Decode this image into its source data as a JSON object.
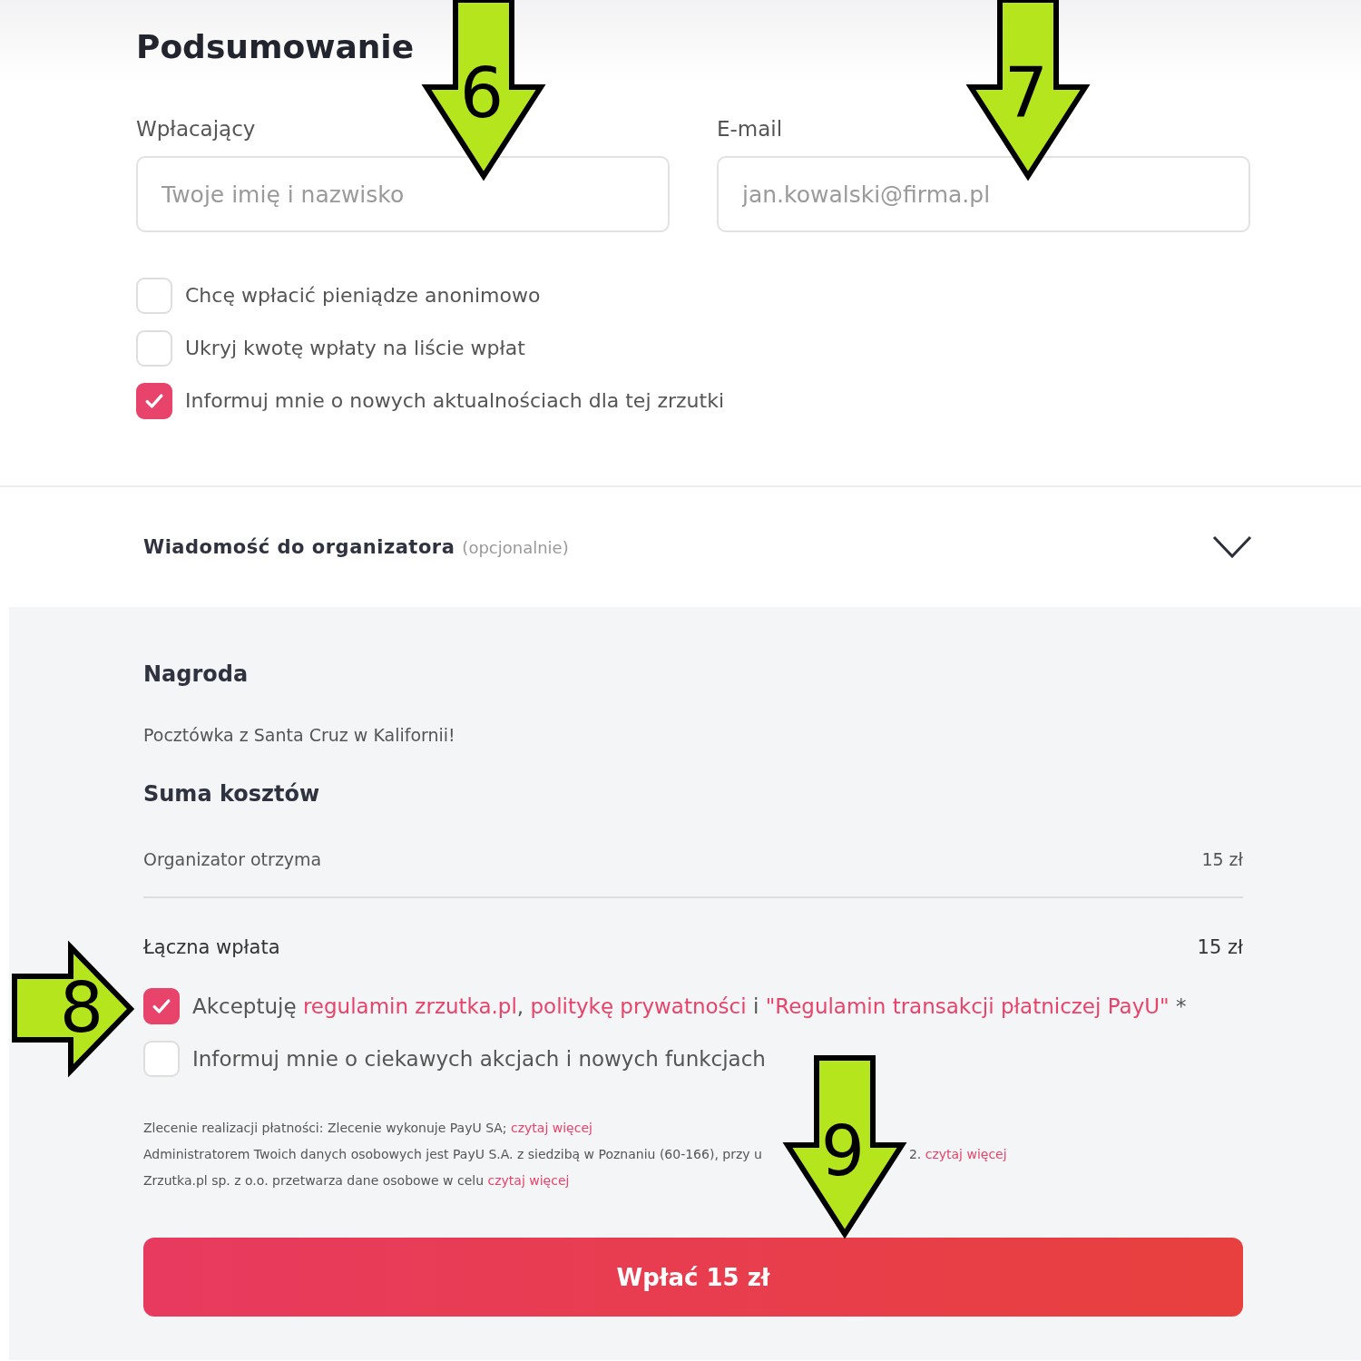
{
  "heading": "Podsumowanie",
  "fields": [
    {
      "label": "Wpłacający",
      "placeholder": "Twoje imię i nazwisko"
    },
    {
      "label": "E-mail",
      "placeholder": "jan.kowalski@firma.pl"
    }
  ],
  "options": [
    {
      "label": "Chcę wpłacić pieniądze anonimowo",
      "checked": false
    },
    {
      "label": "Ukryj kwotę wpłaty na liście wpłat",
      "checked": false
    },
    {
      "label": "Informuj mnie o nowych aktualnościach dla tej zrzutki",
      "checked": true
    }
  ],
  "message_section": {
    "title": "Wiadomość do organizatora",
    "note": "(opcjonalnie)",
    "expanded": false
  },
  "reward": {
    "title": "Nagroda",
    "text": "Pocztówka z Santa Cruz w Kalifornii!"
  },
  "summary": {
    "title": "Suma kosztów",
    "rows": [
      {
        "label": "Organizator otrzyma",
        "value": "15 zł",
        "kind": "sub"
      },
      {
        "label": "Łączna wpłata",
        "value": "15 zł",
        "kind": "total"
      }
    ]
  },
  "consents": [
    {
      "checked": true,
      "parts": [
        {
          "kind": "text",
          "text": "Akceptuję "
        },
        {
          "kind": "link",
          "text": "regulamin zrzutka.pl"
        },
        {
          "kind": "text",
          "text": ", "
        },
        {
          "kind": "link",
          "text": "politykę prywatności"
        },
        {
          "kind": "text",
          "text": " i "
        },
        {
          "kind": "link",
          "text": "\"Regulamin transakcji płatniczej PayU\""
        },
        {
          "kind": "text",
          "text": " *"
        }
      ]
    },
    {
      "checked": false,
      "parts": [
        {
          "kind": "text",
          "text": "Informuj mnie o ciekawych akcjach i nowych funkcjach"
        }
      ]
    }
  ],
  "notices": [
    {
      "parts": [
        {
          "kind": "text",
          "text": "Zlecenie realizacji płatności: Zlecenie wykonuje PayU SA; "
        },
        {
          "kind": "link",
          "text": "czytaj więcej"
        }
      ]
    },
    {
      "parts": [
        {
          "kind": "text",
          "text": "Administratorem Twoich danych osobowych jest PayU S.A. z siedzibą w Poznaniu (60-166), przy u"
        },
        {
          "kind": "covered",
          "text": "2. "
        },
        {
          "kind": "link",
          "text": "czytaj więcej"
        }
      ]
    },
    {
      "parts": [
        {
          "kind": "text",
          "text": "Zrzutka.pl sp. z o.o. przetwarza dane osobowe w celu "
        },
        {
          "kind": "link",
          "text": "czytaj więcej"
        }
      ]
    }
  ],
  "pay_button": "Wpłać 15 zł",
  "annotations": [
    {
      "number": "6",
      "kind": "down"
    },
    {
      "number": "7",
      "kind": "down"
    },
    {
      "number": "8",
      "kind": "right"
    },
    {
      "number": "9",
      "kind": "down"
    }
  ]
}
